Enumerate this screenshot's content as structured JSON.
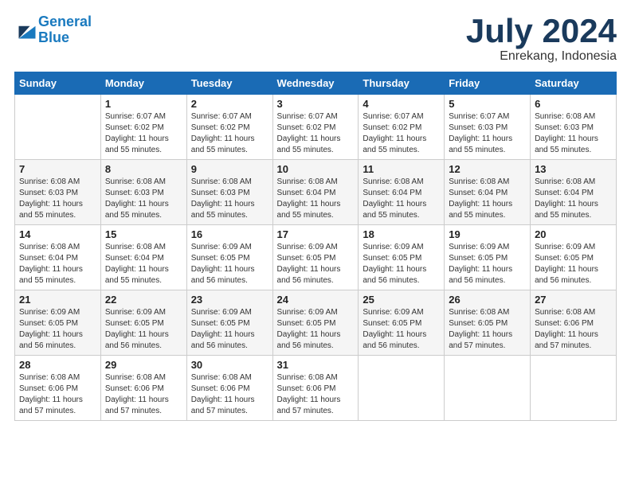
{
  "logo": {
    "line1": "General",
    "line2": "Blue"
  },
  "header": {
    "month": "July 2024",
    "location": "Enrekang, Indonesia"
  },
  "weekdays": [
    "Sunday",
    "Monday",
    "Tuesday",
    "Wednesday",
    "Thursday",
    "Friday",
    "Saturday"
  ],
  "weeks": [
    [
      {
        "day": "",
        "info": ""
      },
      {
        "day": "1",
        "info": "Sunrise: 6:07 AM\nSunset: 6:02 PM\nDaylight: 11 hours\nand 55 minutes."
      },
      {
        "day": "2",
        "info": "Sunrise: 6:07 AM\nSunset: 6:02 PM\nDaylight: 11 hours\nand 55 minutes."
      },
      {
        "day": "3",
        "info": "Sunrise: 6:07 AM\nSunset: 6:02 PM\nDaylight: 11 hours\nand 55 minutes."
      },
      {
        "day": "4",
        "info": "Sunrise: 6:07 AM\nSunset: 6:02 PM\nDaylight: 11 hours\nand 55 minutes."
      },
      {
        "day": "5",
        "info": "Sunrise: 6:07 AM\nSunset: 6:03 PM\nDaylight: 11 hours\nand 55 minutes."
      },
      {
        "day": "6",
        "info": "Sunrise: 6:08 AM\nSunset: 6:03 PM\nDaylight: 11 hours\nand 55 minutes."
      }
    ],
    [
      {
        "day": "7",
        "info": "Sunrise: 6:08 AM\nSunset: 6:03 PM\nDaylight: 11 hours\nand 55 minutes."
      },
      {
        "day": "8",
        "info": "Sunrise: 6:08 AM\nSunset: 6:03 PM\nDaylight: 11 hours\nand 55 minutes."
      },
      {
        "day": "9",
        "info": "Sunrise: 6:08 AM\nSunset: 6:03 PM\nDaylight: 11 hours\nand 55 minutes."
      },
      {
        "day": "10",
        "info": "Sunrise: 6:08 AM\nSunset: 6:04 PM\nDaylight: 11 hours\nand 55 minutes."
      },
      {
        "day": "11",
        "info": "Sunrise: 6:08 AM\nSunset: 6:04 PM\nDaylight: 11 hours\nand 55 minutes."
      },
      {
        "day": "12",
        "info": "Sunrise: 6:08 AM\nSunset: 6:04 PM\nDaylight: 11 hours\nand 55 minutes."
      },
      {
        "day": "13",
        "info": "Sunrise: 6:08 AM\nSunset: 6:04 PM\nDaylight: 11 hours\nand 55 minutes."
      }
    ],
    [
      {
        "day": "14",
        "info": "Sunrise: 6:08 AM\nSunset: 6:04 PM\nDaylight: 11 hours\nand 55 minutes."
      },
      {
        "day": "15",
        "info": "Sunrise: 6:08 AM\nSunset: 6:04 PM\nDaylight: 11 hours\nand 55 minutes."
      },
      {
        "day": "16",
        "info": "Sunrise: 6:09 AM\nSunset: 6:05 PM\nDaylight: 11 hours\nand 56 minutes."
      },
      {
        "day": "17",
        "info": "Sunrise: 6:09 AM\nSunset: 6:05 PM\nDaylight: 11 hours\nand 56 minutes."
      },
      {
        "day": "18",
        "info": "Sunrise: 6:09 AM\nSunset: 6:05 PM\nDaylight: 11 hours\nand 56 minutes."
      },
      {
        "day": "19",
        "info": "Sunrise: 6:09 AM\nSunset: 6:05 PM\nDaylight: 11 hours\nand 56 minutes."
      },
      {
        "day": "20",
        "info": "Sunrise: 6:09 AM\nSunset: 6:05 PM\nDaylight: 11 hours\nand 56 minutes."
      }
    ],
    [
      {
        "day": "21",
        "info": "Sunrise: 6:09 AM\nSunset: 6:05 PM\nDaylight: 11 hours\nand 56 minutes."
      },
      {
        "day": "22",
        "info": "Sunrise: 6:09 AM\nSunset: 6:05 PM\nDaylight: 11 hours\nand 56 minutes."
      },
      {
        "day": "23",
        "info": "Sunrise: 6:09 AM\nSunset: 6:05 PM\nDaylight: 11 hours\nand 56 minutes."
      },
      {
        "day": "24",
        "info": "Sunrise: 6:09 AM\nSunset: 6:05 PM\nDaylight: 11 hours\nand 56 minutes."
      },
      {
        "day": "25",
        "info": "Sunrise: 6:09 AM\nSunset: 6:05 PM\nDaylight: 11 hours\nand 56 minutes."
      },
      {
        "day": "26",
        "info": "Sunrise: 6:08 AM\nSunset: 6:05 PM\nDaylight: 11 hours\nand 57 minutes."
      },
      {
        "day": "27",
        "info": "Sunrise: 6:08 AM\nSunset: 6:06 PM\nDaylight: 11 hours\nand 57 minutes."
      }
    ],
    [
      {
        "day": "28",
        "info": "Sunrise: 6:08 AM\nSunset: 6:06 PM\nDaylight: 11 hours\nand 57 minutes."
      },
      {
        "day": "29",
        "info": "Sunrise: 6:08 AM\nSunset: 6:06 PM\nDaylight: 11 hours\nand 57 minutes."
      },
      {
        "day": "30",
        "info": "Sunrise: 6:08 AM\nSunset: 6:06 PM\nDaylight: 11 hours\nand 57 minutes."
      },
      {
        "day": "31",
        "info": "Sunrise: 6:08 AM\nSunset: 6:06 PM\nDaylight: 11 hours\nand 57 minutes."
      },
      {
        "day": "",
        "info": ""
      },
      {
        "day": "",
        "info": ""
      },
      {
        "day": "",
        "info": ""
      }
    ]
  ]
}
